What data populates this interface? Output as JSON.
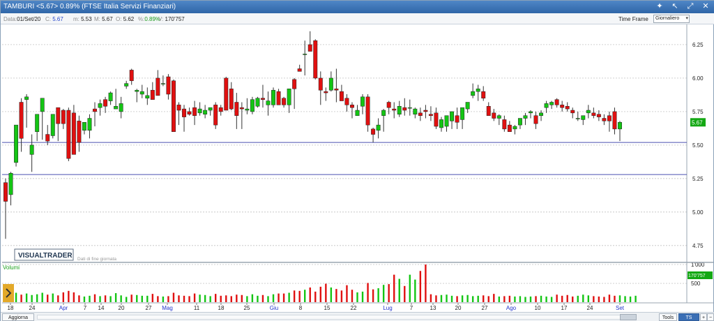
{
  "window": {
    "title": "TAMBURI <5.67> 0.89%  (FTSE Italia Servizi Finanziari)",
    "buttons": [
      "✦",
      "↖",
      "⤢",
      "✕"
    ]
  },
  "infobar": {
    "data_label": "Data:",
    "data_value": "01/Set/20",
    "c_label": "C:",
    "c_value": "5.67",
    "m_label": "m:",
    "m_value": "5.53",
    "M_label": "M:",
    "M_value": "5.67",
    "o_label": "O:",
    "o_value": "5.62",
    "pct_label": "%:",
    "pct_value": "0.89%",
    "v_label": "V:",
    "v_value": "170'757",
    "timeframe_label": "Time Frame",
    "timeframe_value": "Giornaliero"
  },
  "watermark": {
    "brand": "VISUALTRADER",
    "note": "Dati di fine giornata"
  },
  "volume_label": "Volumi",
  "bottombar": {
    "aggiorna": "Aggiorna",
    "tools": "Tools",
    "ts_off": "TS OFF",
    "plus": "+",
    "minus": "−"
  },
  "colors": {
    "up": "#14c514",
    "down": "#e01010",
    "hline": "#4a4fb0",
    "price_tag": "#14a814"
  },
  "chart_data": [
    {
      "type": "candlestick",
      "title": "TAMBURI",
      "x_tick_labels": [
        {
          "label": "18",
          "month": false
        },
        {
          "label": "24",
          "month": false
        },
        {
          "label": "Apr",
          "month": true
        },
        {
          "label": "7",
          "month": false
        },
        {
          "label": "14",
          "month": false
        },
        {
          "label": "20",
          "month": false
        },
        {
          "label": "27",
          "month": false
        },
        {
          "label": "Mag",
          "month": true
        },
        {
          "label": "11",
          "month": false
        },
        {
          "label": "18",
          "month": false
        },
        {
          "label": "25",
          "month": false
        },
        {
          "label": "Giu",
          "month": true
        },
        {
          "label": "8",
          "month": false
        },
        {
          "label": "15",
          "month": false
        },
        {
          "label": "22",
          "month": false
        },
        {
          "label": "Lug",
          "month": true
        },
        {
          "label": "7",
          "month": false
        },
        {
          "label": "13",
          "month": false
        },
        {
          "label": "20",
          "month": false
        },
        {
          "label": "27",
          "month": false
        },
        {
          "label": "Ago",
          "month": true
        },
        {
          "label": "10",
          "month": false
        },
        {
          "label": "17",
          "month": false
        },
        {
          "label": "24",
          "month": false
        },
        {
          "label": "Set",
          "month": true
        }
      ],
      "y_ticks": [
        "6.25",
        "6.00",
        "5.75",
        "5.50",
        "5.25",
        "5.00",
        "4.75"
      ],
      "ylim": [
        4.64,
        6.38
      ],
      "last_price": "5.67",
      "horizontal_lines": [
        5.52,
        5.28
      ],
      "ohlc": [
        [
          5.22,
          5.25,
          4.8,
          5.08
        ],
        [
          5.13,
          5.3,
          5.05,
          5.29
        ],
        [
          5.37,
          5.65,
          5.34,
          5.65
        ],
        [
          5.82,
          5.85,
          5.45,
          5.55
        ],
        [
          5.84,
          5.88,
          5.63,
          5.86
        ],
        [
          5.43,
          5.58,
          5.3,
          5.5
        ],
        [
          5.6,
          5.7,
          5.53,
          5.73
        ],
        [
          5.75,
          5.84,
          5.54,
          5.85
        ],
        [
          5.58,
          5.65,
          5.5,
          5.53
        ],
        [
          5.57,
          5.65,
          5.55,
          5.73
        ],
        [
          5.78,
          5.78,
          5.53,
          5.66
        ],
        [
          5.76,
          5.77,
          5.62,
          5.66
        ],
        [
          5.76,
          5.78,
          5.38,
          5.4
        ],
        [
          5.74,
          5.8,
          5.48,
          5.43
        ],
        [
          5.68,
          5.72,
          5.45,
          5.52
        ],
        [
          5.61,
          5.66,
          5.58,
          5.67
        ],
        [
          5.61,
          5.73,
          5.55,
          5.7
        ],
        [
          5.77,
          5.82,
          5.64,
          5.75
        ],
        [
          5.78,
          5.84,
          5.72,
          5.81
        ],
        [
          5.84,
          5.86,
          5.74,
          5.79
        ],
        [
          5.83,
          5.9,
          5.8,
          5.89
        ],
        [
          5.77,
          5.92,
          5.78,
          5.79
        ],
        [
          5.75,
          5.86,
          5.7,
          5.81
        ],
        [
          5.94,
          5.98,
          5.92,
          5.96
        ],
        [
          6.06,
          6.07,
          5.95,
          5.98
        ],
        [
          5.9,
          5.92,
          5.82,
          5.91
        ],
        [
          5.88,
          5.95,
          5.85,
          5.9
        ],
        [
          5.85,
          5.93,
          5.8,
          5.87
        ],
        [
          5.91,
          5.97,
          5.85,
          5.84
        ],
        [
          6.0,
          6.06,
          5.87,
          5.87
        ],
        [
          5.96,
          6.02,
          5.94,
          5.96
        ],
        [
          6.01,
          6.03,
          5.84,
          5.88
        ],
        [
          5.98,
          5.99,
          5.8,
          5.6
        ],
        [
          5.8,
          5.82,
          5.65,
          5.76
        ],
        [
          5.77,
          5.8,
          5.6,
          5.71
        ],
        [
          5.75,
          5.78,
          5.72,
          5.73
        ],
        [
          5.78,
          5.83,
          5.65,
          5.72
        ],
        [
          5.74,
          5.82,
          5.72,
          5.77
        ],
        [
          5.73,
          5.8,
          5.7,
          5.76
        ],
        [
          5.76,
          5.78,
          5.72,
          5.78
        ],
        [
          5.8,
          5.82,
          5.62,
          5.65
        ],
        [
          5.78,
          5.8,
          5.72,
          5.75
        ],
        [
          6.0,
          6.01,
          5.76,
          5.76
        ],
        [
          5.92,
          5.97,
          5.76,
          5.77
        ],
        [
          5.82,
          5.89,
          5.62,
          5.72
        ],
        [
          5.78,
          5.82,
          5.62,
          5.77
        ],
        [
          5.76,
          5.85,
          5.73,
          5.77
        ],
        [
          5.75,
          5.86,
          5.73,
          5.84
        ],
        [
          5.79,
          5.86,
          5.78,
          5.85
        ],
        [
          5.85,
          5.95,
          5.78,
          5.84
        ],
        [
          5.8,
          5.9,
          5.72,
          5.83
        ],
        [
          5.8,
          5.93,
          5.78,
          5.91
        ],
        [
          5.9,
          5.92,
          5.8,
          5.8
        ],
        [
          5.85,
          5.86,
          5.78,
          5.8
        ],
        [
          5.8,
          5.86,
          5.74,
          5.92
        ],
        [
          5.99,
          6.0,
          5.77,
          5.92
        ],
        [
          6.07,
          6.1,
          6.05,
          6.05
        ],
        [
          6.18,
          6.28,
          6.02,
          6.18
        ],
        [
          6.25,
          6.35,
          6.2,
          6.2
        ],
        [
          6.28,
          6.29,
          5.99,
          6.0
        ],
        [
          6.0,
          6.05,
          5.8,
          5.91
        ],
        [
          5.9,
          5.93,
          5.83,
          5.89
        ],
        [
          5.91,
          6.05,
          5.9,
          6.0
        ],
        [
          5.92,
          6.07,
          5.82,
          5.91
        ],
        [
          5.9,
          5.95,
          5.86,
          5.83
        ],
        [
          5.85,
          5.88,
          5.75,
          5.8
        ],
        [
          5.8,
          5.82,
          5.7,
          5.78
        ],
        [
          5.72,
          5.8,
          5.72,
          5.76
        ],
        [
          5.79,
          5.88,
          5.73,
          5.86
        ],
        [
          5.86,
          5.88,
          5.6,
          5.65
        ],
        [
          5.62,
          5.63,
          5.52,
          5.58
        ],
        [
          5.61,
          5.7,
          5.55,
          5.65
        ],
        [
          5.72,
          5.77,
          5.6,
          5.76
        ],
        [
          5.82,
          5.83,
          5.73,
          5.78
        ],
        [
          5.77,
          5.82,
          5.7,
          5.76
        ],
        [
          5.73,
          5.83,
          5.71,
          5.79
        ],
        [
          5.78,
          5.85,
          5.72,
          5.76
        ],
        [
          5.78,
          5.84,
          5.72,
          5.78
        ],
        [
          5.73,
          5.78,
          5.7,
          5.77
        ],
        [
          5.74,
          5.78,
          5.68,
          5.72
        ],
        [
          5.76,
          5.8,
          5.7,
          5.75
        ],
        [
          5.73,
          5.79,
          5.68,
          5.72
        ],
        [
          5.74,
          5.78,
          5.62,
          5.64
        ],
        [
          5.63,
          5.71,
          5.6,
          5.69
        ],
        [
          5.64,
          5.72,
          5.6,
          5.72
        ],
        [
          5.68,
          5.74,
          5.62,
          5.75
        ],
        [
          5.72,
          5.78,
          5.62,
          5.67
        ],
        [
          5.69,
          5.77,
          5.62,
          5.78
        ],
        [
          5.77,
          5.8,
          5.74,
          5.82
        ],
        [
          5.87,
          5.96,
          5.85,
          5.9
        ],
        [
          5.9,
          5.95,
          5.83,
          5.92
        ],
        [
          5.9,
          5.94,
          5.83,
          5.85
        ],
        [
          5.79,
          5.82,
          5.72,
          5.72
        ],
        [
          5.74,
          5.77,
          5.68,
          5.7
        ],
        [
          5.7,
          5.73,
          5.65,
          5.72
        ],
        [
          5.69,
          5.72,
          5.6,
          5.62
        ],
        [
          5.65,
          5.68,
          5.6,
          5.6
        ],
        [
          5.62,
          5.65,
          5.58,
          5.64
        ],
        [
          5.65,
          5.7,
          5.62,
          5.7
        ],
        [
          5.7,
          5.74,
          5.65,
          5.72
        ],
        [
          5.74,
          5.76,
          5.7,
          5.75
        ],
        [
          5.72,
          5.75,
          5.62,
          5.66
        ],
        [
          5.72,
          5.76,
          5.68,
          5.74
        ],
        [
          5.78,
          5.83,
          5.74,
          5.81
        ],
        [
          5.8,
          5.83,
          5.77,
          5.82
        ],
        [
          5.84,
          5.85,
          5.78,
          5.8
        ],
        [
          5.8,
          5.83,
          5.75,
          5.78
        ],
        [
          5.79,
          5.82,
          5.75,
          5.77
        ],
        [
          5.76,
          5.78,
          5.7,
          5.74
        ],
        [
          5.7,
          5.75,
          5.68,
          5.7
        ],
        [
          5.69,
          5.72,
          5.65,
          5.72
        ],
        [
          5.74,
          5.8,
          5.7,
          5.76
        ],
        [
          5.74,
          5.78,
          5.7,
          5.72
        ],
        [
          5.73,
          5.76,
          5.68,
          5.71
        ],
        [
          5.7,
          5.73,
          5.65,
          5.68
        ],
        [
          5.72,
          5.75,
          5.6,
          5.68
        ],
        [
          5.75,
          5.78,
          5.58,
          5.62
        ],
        [
          5.62,
          5.68,
          5.53,
          5.67
        ]
      ],
      "volume": {
        "label": "Volumi",
        "y_ticks": [
          "1'000",
          "500"
        ],
        "ylim": [
          0,
          1020
        ],
        "last_value": "170'757",
        "values": [
          320,
          240,
          250,
          200,
          230,
          190,
          210,
          250,
          200,
          230,
          180,
          260,
          300,
          260,
          180,
          150,
          170,
          210,
          160,
          180,
          160,
          240,
          180,
          140,
          200,
          190,
          170,
          170,
          220,
          160,
          150,
          160,
          250,
          180,
          170,
          160,
          230,
          200,
          190,
          160,
          220,
          170,
          180,
          160,
          200,
          190,
          160,
          210,
          170,
          190,
          160,
          210,
          230,
          230,
          250,
          310,
          300,
          330,
          390,
          280,
          410,
          490,
          390,
          350,
          310,
          450,
          330,
          260,
          280,
          510,
          340,
          370,
          460,
          480,
          730,
          620,
          430,
          730,
          600,
          830,
          1000,
          210,
          180,
          190,
          200,
          170,
          160,
          180,
          190,
          160,
          170,
          180,
          160,
          220,
          150,
          160,
          170,
          150,
          160,
          140,
          150,
          160,
          170,
          150,
          140,
          200,
          170,
          190,
          150,
          170,
          200,
          180,
          160,
          150,
          140,
          200,
          170,
          180,
          160,
          150,
          170
        ]
      }
    }
  ]
}
